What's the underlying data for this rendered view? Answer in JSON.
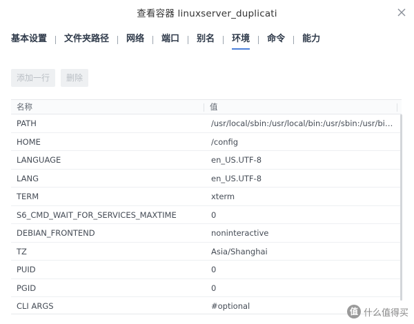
{
  "dialog": {
    "title": "查看容器 linuxserver_duplicati",
    "close_icon": "close-icon"
  },
  "tabs": [
    {
      "label": "基本设置",
      "active": false
    },
    {
      "label": "文件夹路径",
      "active": false
    },
    {
      "label": "网络",
      "active": false
    },
    {
      "label": "端口",
      "active": false
    },
    {
      "label": "别名",
      "active": false
    },
    {
      "label": "环境",
      "active": true
    },
    {
      "label": "命令",
      "active": false
    },
    {
      "label": "能力",
      "active": false
    }
  ],
  "toolbar": {
    "add_label": "添加一行",
    "delete_label": "删除"
  },
  "table": {
    "headers": {
      "name": "名称",
      "value": "值"
    },
    "rows": [
      {
        "name": "PATH",
        "value": "/usr/local/sbin:/usr/local/bin:/usr/sbin:/usr/bin:/..."
      },
      {
        "name": "HOME",
        "value": "/config"
      },
      {
        "name": "LANGUAGE",
        "value": "en_US.UTF-8"
      },
      {
        "name": "LANG",
        "value": "en_US.UTF-8"
      },
      {
        "name": "TERM",
        "value": "xterm"
      },
      {
        "name": "S6_CMD_WAIT_FOR_SERVICES_MAXTIME",
        "value": "0"
      },
      {
        "name": "DEBIAN_FRONTEND",
        "value": "noninteractive"
      },
      {
        "name": "TZ",
        "value": "Asia/Shanghai"
      },
      {
        "name": "PUID",
        "value": "0"
      },
      {
        "name": "PGID",
        "value": "0"
      },
      {
        "name": "CLI ARGS",
        "value": "#optional"
      }
    ]
  },
  "watermark": {
    "logo_glyph": "值",
    "text": "什么值得买"
  },
  "colors": {
    "accent": "#4a7ed9",
    "tab_text": "#2f3a4a",
    "disabled_button_bg": "#eef0f2",
    "disabled_button_text": "#b9bec4"
  }
}
